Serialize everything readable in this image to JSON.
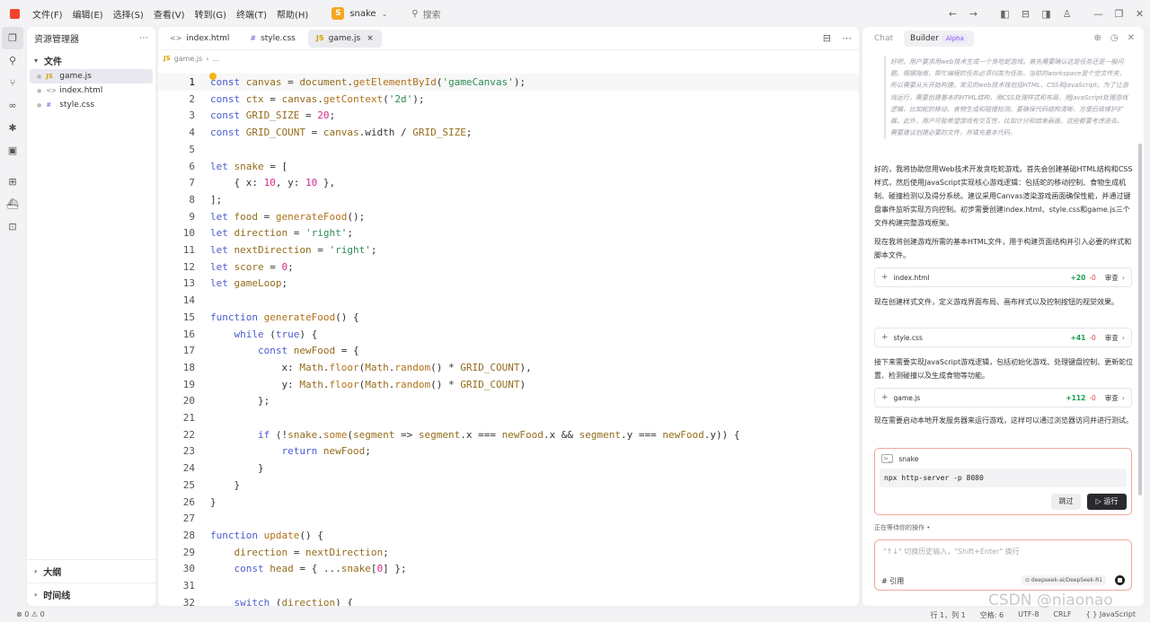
{
  "menu": [
    "文件(F)",
    "编辑(E)",
    "选择(S)",
    "查看(V)",
    "转到(G)",
    "终端(T)",
    "帮助(H)"
  ],
  "project": {
    "badge": "S",
    "name": "snake"
  },
  "search_label": "搜索",
  "explorer": {
    "title": "资源管理器",
    "folder": "文件",
    "files": [
      {
        "icon": "JS",
        "name": "game.js"
      },
      {
        "icon": "<>",
        "name": "index.html"
      },
      {
        "icon": "#",
        "name": "style.css"
      }
    ],
    "outline": "大纲",
    "timeline": "时间线"
  },
  "tabs": [
    {
      "icon": "<>",
      "name": "index.html"
    },
    {
      "icon": "#",
      "name": "style.css"
    },
    {
      "icon": "JS",
      "name": "game.js",
      "close": "×"
    }
  ],
  "breadcrumb": {
    "icon": "JS",
    "file": "game.js",
    "sep": "›",
    "rest": "..."
  },
  "code_lines": [
    {
      "n": "1",
      "h": "<span class=kw>const</span> <span class=vr>canvas</span> = <span class=vr>document</span>.<span class=fn>getElementById</span>(<span class=str>'gameCanvas'</span>);"
    },
    {
      "n": "2",
      "h": "<span class=kw>const</span> <span class=vr>ctx</span> = <span class=vr>canvas</span>.<span class=fn>getContext</span>(<span class=str>'2d'</span>);"
    },
    {
      "n": "3",
      "h": "<span class=kw>const</span> <span class=vr>GRID_SIZE</span> = <span class=num>20</span>;"
    },
    {
      "n": "4",
      "h": "<span class=kw>const</span> <span class=vr>GRID_COUNT</span> = <span class=vr>canvas</span>.width / <span class=vr>GRID_SIZE</span>;"
    },
    {
      "n": "5",
      "h": ""
    },
    {
      "n": "6",
      "h": "<span class=kw>let</span> <span class=vr>snake</span> = ["
    },
    {
      "n": "7",
      "h": "    { x: <span class=num>10</span>, y: <span class=num>10</span> },"
    },
    {
      "n": "8",
      "h": "];"
    },
    {
      "n": "9",
      "h": "<span class=kw>let</span> <span class=vr>food</span> = <span class=fn>generateFood</span>();"
    },
    {
      "n": "10",
      "h": "<span class=kw>let</span> <span class=vr>direction</span> = <span class=str>'right'</span>;"
    },
    {
      "n": "11",
      "h": "<span class=kw>let</span> <span class=vr>nextDirection</span> = <span class=str>'right'</span>;"
    },
    {
      "n": "12",
      "h": "<span class=kw>let</span> <span class=vr>score</span> = <span class=num>0</span>;"
    },
    {
      "n": "13",
      "h": "<span class=kw>let</span> <span class=vr>gameLoop</span>;"
    },
    {
      "n": "14",
      "h": ""
    },
    {
      "n": "15",
      "h": "<span class=kw>function</span> <span class=fn>generateFood</span>() {"
    },
    {
      "n": "16",
      "h": "    <span class=kw>while</span> (<span class=kw>true</span>) {"
    },
    {
      "n": "17",
      "h": "        <span class=kw>const</span> <span class=vr>newFood</span> = {"
    },
    {
      "n": "18",
      "h": "            x: <span class=vr>Math</span>.<span class=fn>floor</span>(<span class=vr>Math</span>.<span class=fn>random</span>() * <span class=vr>GRID_COUNT</span>),"
    },
    {
      "n": "19",
      "h": "            y: <span class=vr>Math</span>.<span class=fn>floor</span>(<span class=vr>Math</span>.<span class=fn>random</span>() * <span class=vr>GRID_COUNT</span>)"
    },
    {
      "n": "20",
      "h": "        };"
    },
    {
      "n": "21",
      "h": ""
    },
    {
      "n": "22",
      "h": "        <span class=kw>if</span> (!<span class=vr>snake</span>.<span class=fn>some</span>(<span class=vr>segment</span> => <span class=vr>segment</span>.x === <span class=vr>newFood</span>.x && <span class=vr>segment</span>.y === <span class=vr>newFood</span>.y)) {"
    },
    {
      "n": "23",
      "h": "            <span class=kw>return</span> <span class=vr>newFood</span>;"
    },
    {
      "n": "24",
      "h": "        }"
    },
    {
      "n": "25",
      "h": "    }"
    },
    {
      "n": "26",
      "h": "}"
    },
    {
      "n": "27",
      "h": ""
    },
    {
      "n": "28",
      "h": "<span class=kw>function</span> <span class=fn>update</span>() {"
    },
    {
      "n": "29",
      "h": "    <span class=vr>direction</span> = <span class=vr>nextDirection</span>;"
    },
    {
      "n": "30",
      "h": "    <span class=kw>const</span> <span class=vr>head</span> = { ...<span class=vr>snake</span>[<span class=num>0</span>] };"
    },
    {
      "n": "31",
      "h": ""
    },
    {
      "n": "32",
      "h": "    <span class=kw>switch</span> (<span class=vr>direction</span>) {"
    }
  ],
  "chat": {
    "tab_chat": "Chat",
    "tab_builder": "Builder",
    "alpha": "Alpha",
    "thinking": "好吧，用户要求用web技术生成一个贪吃蛇游戏。首先需要确认这是任务还是一般问题。根据指南，帮忙编程的任务必须归类为任务。当前的workspace是个空文件夹，所以需要从头开始构建。常见的web技术栈包括HTML、CSS和JavaScript。为了让游戏运行，需要创建基本的HTML结构，用CSS处理样式和布局，用JavaScript处理游戏逻辑，比如蛇的移动、食物生成和碰撞检测。要确保代码结构清晰，方便后续维护扩展。此外，用户可能希望游戏有交互性，比如计分和结束画面，这些都要考虑进去。需要建议创建必要的文件，并填充基本代码。",
    "msg1": "好的，我将协助您用Web技术开发贪吃蛇游戏。首先会创建基础HTML结构和CSS样式，然后使用JavaScript实现核心游戏逻辑：包括蛇的移动控制、食物生成机制、碰撞检测以及得分系统。建议采用Canvas渲染游戏画面确保性能，并通过键盘事件监听实现方向控制。初步需要创建index.html、style.css和game.js三个文件构建完整游戏框架。",
    "msg2": "现在我将创建游戏所需的基本HTML文件，用于构建页面结构并引入必要的样式和脚本文件。",
    "msg3": "现在创建样式文件，定义游戏界面布局、画布样式以及控制按钮的视觉效果。",
    "msg4": "接下来需要实现JavaScript游戏逻辑，包括初始化游戏、处理键盘控制、更新蛇位置、检测碰撞以及生成食物等功能。",
    "msg5": "现在需要启动本地开发服务器来运行游戏，这样可以通过浏览器访问并进行测试。",
    "cards": [
      {
        "plus": "+",
        "name": "index.html",
        "add": "+20",
        "del": "-0",
        "review": "审查",
        "chev": "›"
      },
      {
        "plus": "+",
        "name": "style.css",
        "add": "+41",
        "del": "-0",
        "review": "审查",
        "chev": "›"
      },
      {
        "plus": "+",
        "name": "game.js",
        "add": "+112",
        "del": "-0",
        "review": "审查",
        "chev": "›"
      }
    ],
    "terminal": {
      "icon": ">_",
      "name": "snake",
      "command": "npx http-server -p 8080",
      "skip": "跳过",
      "run": "▷ 运行"
    },
    "waiting": "正在等待你的操作 •",
    "input_placeholder": "\"↑↓\" 切换历史输入，\"Shift+Enter\" 换行",
    "reference": "# 引用",
    "model": "⊙ deepseek-ai/DeepSeek-R1"
  },
  "status": {
    "left": "⊗ 0 ⚠ 0",
    "position": "行 1，列 1",
    "spaces": "空格: 6",
    "encoding": "UTF-8",
    "eol": "CRLF",
    "language": "{ } JavaScript"
  },
  "watermark": "CSDN @niaonao"
}
